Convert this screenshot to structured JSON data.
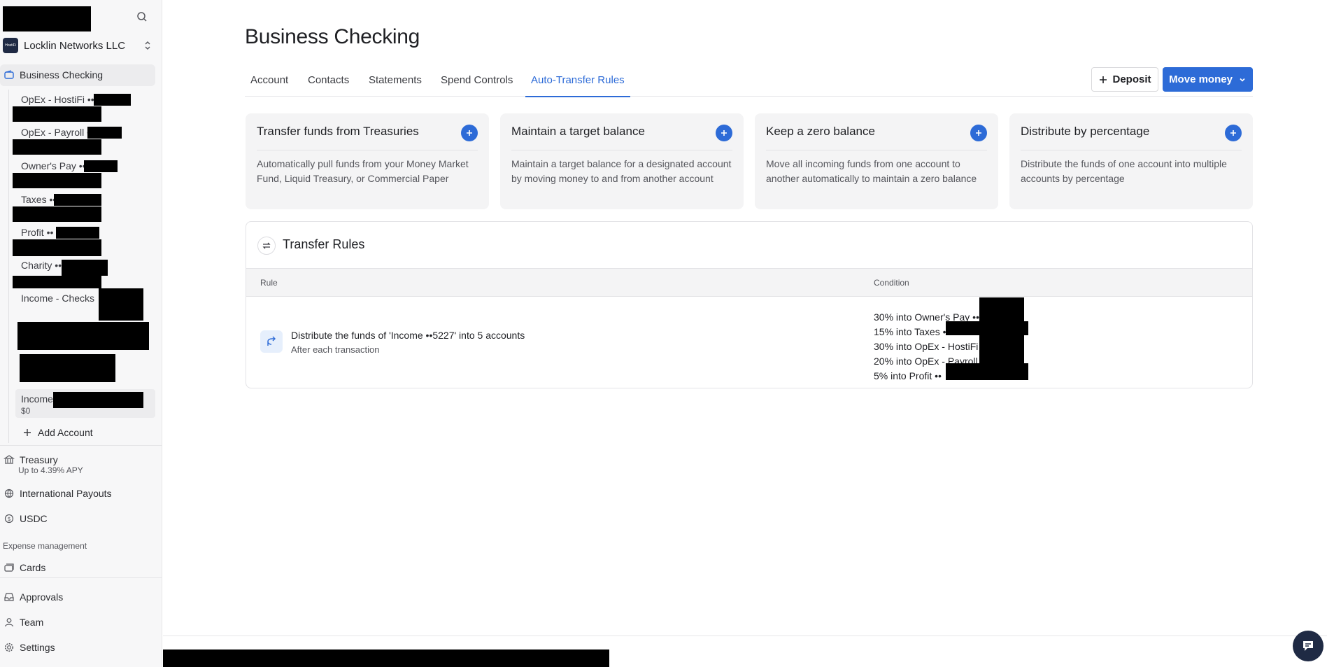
{
  "sidebar": {
    "org_name": "Locklin Networks LLC",
    "org_logo_text": "HostiFi",
    "active_account": "Business Checking",
    "sub_accounts": [
      {
        "label": "OpEx - HostiFi ••"
      },
      {
        "label": "OpEx - Payroll ••"
      },
      {
        "label": "Owner's Pay ••"
      },
      {
        "label": "Taxes ••"
      },
      {
        "label": "Profit ••"
      },
      {
        "label": "Charity ••"
      },
      {
        "label": "Income - Checks"
      }
    ],
    "income_card": {
      "label": "Income",
      "balance": "$0"
    },
    "add_account": "Add Account",
    "treasury": {
      "label": "Treasury",
      "sub": "Up to 4.39% APY"
    },
    "international": "International Payouts",
    "usdc": "USDC",
    "expense_section": "Expense management",
    "cards": "Cards",
    "approvals": "Approvals",
    "team": "Team",
    "settings": "Settings"
  },
  "main": {
    "title": "Business Checking",
    "tabs": [
      "Account",
      "Contacts",
      "Statements",
      "Spend Controls",
      "Auto-Transfer Rules"
    ],
    "active_tab": "Auto-Transfer Rules",
    "deposit_label": "Deposit",
    "move_money_label": "Move money",
    "cards": [
      {
        "title": "Transfer funds from Treasuries",
        "desc": "Automatically pull funds from your Money Market Fund, Liquid Treasury, or Commercial Paper"
      },
      {
        "title": "Maintain a target balance",
        "desc": "Maintain a target balance for a designated account by moving money to and from another account"
      },
      {
        "title": "Keep a zero balance",
        "desc": "Move all incoming funds from one account to another automatically to maintain a zero balance"
      },
      {
        "title": "Distribute by percentage",
        "desc": "Distribute the funds of one account into multiple accounts by percentage"
      }
    ],
    "rules": {
      "title": "Transfer Rules",
      "col_rule": "Rule",
      "col_condition": "Condition",
      "row": {
        "rule": "Distribute the funds of 'Income ••5227' into 5 accounts",
        "sub": "After each transaction",
        "conditions": [
          "30% into Owner's Pay ••",
          "15% into Taxes ••",
          "30% into OpEx - HostiFi ••",
          "20% into OpEx - Payroll ••",
          "5% into Profit ••"
        ]
      }
    }
  },
  "colors": {
    "accent": "#2d6bd7",
    "sidebar_bg": "#f7f7f8",
    "card_bg": "#f4f4f5"
  }
}
